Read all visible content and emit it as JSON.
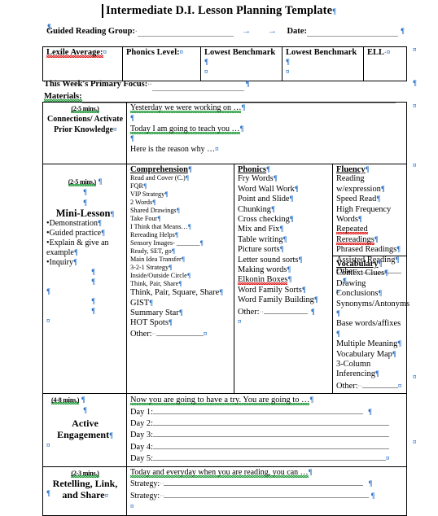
{
  "document": {
    "title": "Intermediate D.I. Lesson Planning Template",
    "header": {
      "guided_reading_label": "Guided Reading Group:",
      "date_label": "Date:"
    },
    "info_row": {
      "lexile": "Lexile Average:",
      "phonics_level": "Phonics Level:",
      "lowest_benchmark_1": "Lowest Benchmark",
      "lowest_benchmark_2": "Lowest Benchmark",
      "ell": "ELL"
    },
    "focus": {
      "primary_focus_label": "This Week's Primary Focus:",
      "materials_label": "Materials:"
    },
    "sections": {
      "connections": {
        "mins": "(2-5 mins.)",
        "label": "Connections/ Activate Prior Knowledge",
        "lines": [
          "Yesterday we were working on …",
          "Today I am going to teach you …",
          "Here is the reason why …"
        ]
      },
      "mini_lesson": {
        "mins": "(2-5 mins.)",
        "label": "Mini-Lesson",
        "bullets": [
          "Demonstration",
          "Guided practice",
          "Explain & give an example",
          "Inquiry"
        ]
      },
      "active_engagement": {
        "mins": "(4-8 mins.)",
        "label": "Active Engagement",
        "prompt": "Now you are going to have a try. You are going to …",
        "days": [
          "Day 1:",
          "Day 2:",
          "Day 3:",
          "Day 4:",
          "Day 5:"
        ]
      },
      "retelling": {
        "mins": "(2-3 mins.)",
        "label": "Retelling, Link, and Share",
        "prompt": "Today and everyday when you are reading, you can …",
        "strategies": [
          "Strategy:",
          "Strategy:"
        ]
      }
    },
    "strategy_columns": {
      "comprehension": {
        "heading": "Comprehension",
        "items_small": [
          "Read and Cover (C.)",
          "FQR",
          "VIP Strategy",
          "2 Words",
          "Shared Drawings",
          "Take Four",
          "I Think that Means…",
          "Rereading Helps",
          "Sensory Images- _______",
          "Ready, SET, go",
          "Main Idea Transfer",
          "3-2-1 Strategy",
          "Inside/Outside Circle",
          "Think, Pair, Share"
        ],
        "items_large": [
          "Think, Pair, Square, Share",
          "GIST",
          "Summary Star",
          "HOT Spots"
        ],
        "other": "Other:"
      },
      "phonics": {
        "heading": "Phonics",
        "items": [
          "Fry Words",
          "Word Wall Work",
          "Point and Slide",
          "Chunking",
          "Cross checking",
          "Mix and Fix",
          "Table writing",
          "Picture sorts",
          "Letter sound sorts",
          "Making words",
          "Elkonin Boxes",
          "Word Family Sorts",
          "Word Family Building"
        ],
        "other": "Other:"
      },
      "fluency": {
        "heading": "Fluency",
        "items": [
          "Reading w/expression",
          "Speed Read",
          "High Frequency Words",
          "Repeated Rereadings",
          "Phrased Readings",
          "Assisted Reading"
        ],
        "other": "Other:"
      },
      "vocabulary": {
        "heading": "Vocabulary",
        "items": [
          "Context Clues",
          "Drawing Conclusions",
          "Synonyms/Antonyms",
          "Base words/affixes",
          "Multiple Meaning",
          "Vocabulary Map",
          "3-Column Inferencing"
        ],
        "other": "Other:"
      }
    },
    "marks": {
      "pilcrow": "¶",
      "cell_end": "¤",
      "tab_arrow": "→"
    }
  }
}
